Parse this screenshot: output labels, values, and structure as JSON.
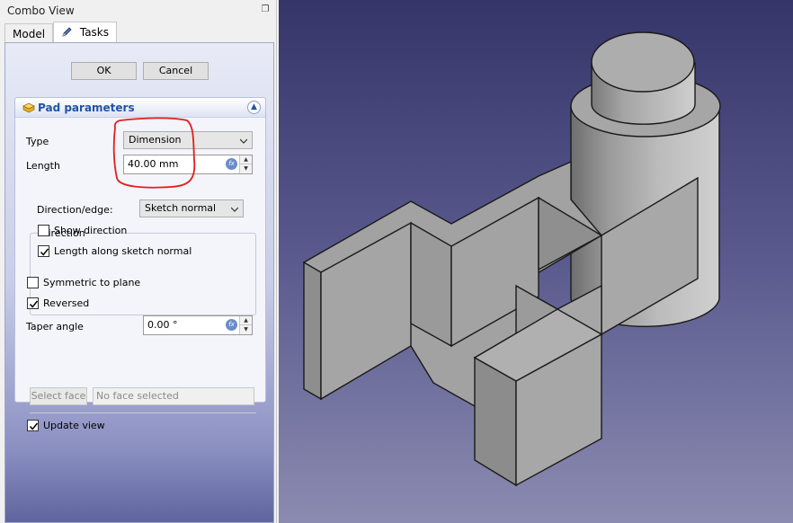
{
  "combo_view": {
    "title": "Combo View",
    "tabs": [
      {
        "label": "Model",
        "active": false
      },
      {
        "label": "Tasks",
        "active": true
      }
    ]
  },
  "buttons": {
    "ok": "OK",
    "cancel": "Cancel"
  },
  "pad": {
    "title": "Pad parameters",
    "type_label": "Type",
    "type_value": "Dimension",
    "length_label": "Length",
    "length_value": "40.00 mm",
    "direction_title": "Direction",
    "direction_edge_label": "Direction/edge:",
    "direction_edge_value": "Sketch normal",
    "show_direction_label": "Show direction",
    "show_direction_checked": false,
    "length_along_normal_label": "Length along sketch normal",
    "length_along_normal_checked": true,
    "symmetric_label": "Symmetric to plane",
    "symmetric_checked": false,
    "reversed_label": "Reversed",
    "reversed_checked": true,
    "taper_label": "Taper angle",
    "taper_value": "0.00 °",
    "select_face_label": "Select face",
    "face_placeholder": "No face selected",
    "update_view_label": "Update view",
    "update_view_checked": true
  },
  "colors": {
    "annotation": "#e0201c",
    "viewport_top": "#35356a",
    "viewport_bottom": "#8b8bb1",
    "part_face": "#a8a8a8"
  },
  "icons": {
    "float": "float-window-icon",
    "tasks": "pencil-icon",
    "pad": "pad-feature-icon",
    "collapse": "collapse-chevron-icon",
    "expression": "fx-expression-icon"
  }
}
